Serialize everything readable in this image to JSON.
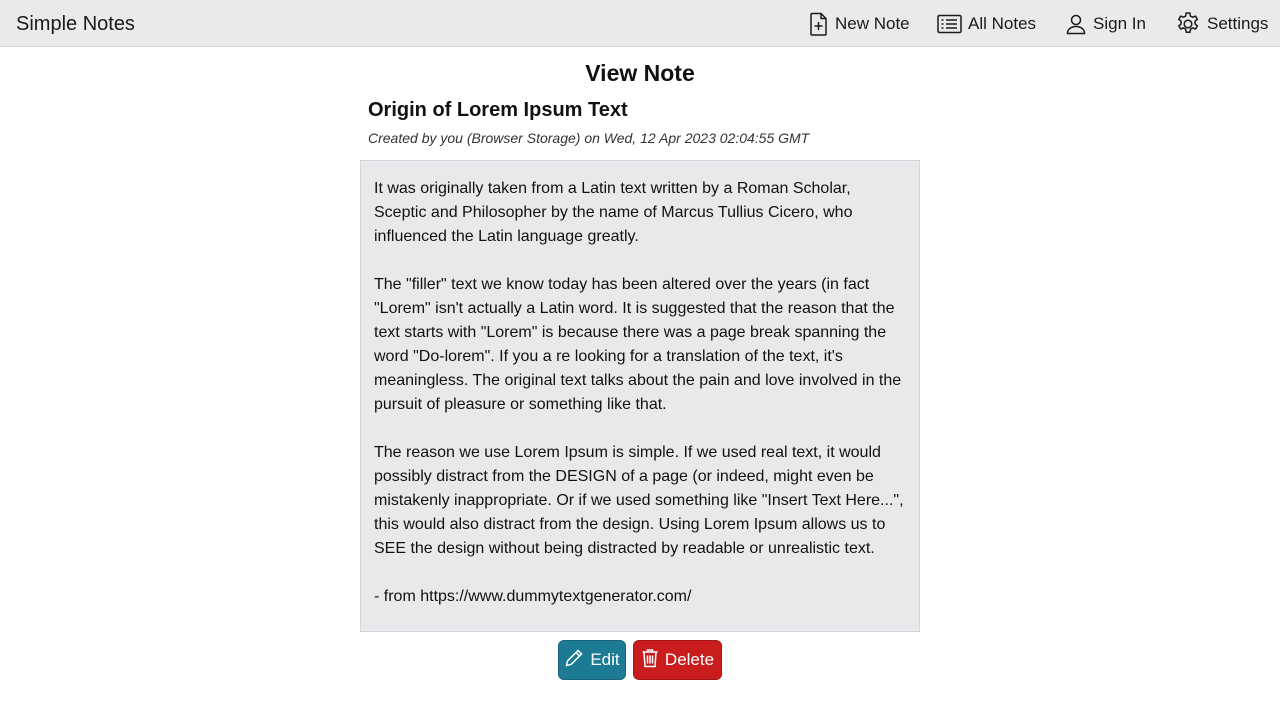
{
  "app": {
    "brand": "Simple Notes"
  },
  "nav": {
    "new_note": "New Note",
    "all_notes": "All Notes",
    "sign_in": "Sign In",
    "settings": "Settings",
    "icons": [
      "file-plus-icon",
      "list-icon",
      "user-icon",
      "gear-icon"
    ]
  },
  "page": {
    "title": "View Note"
  },
  "note": {
    "title": "Origin of Lorem Ipsum Text",
    "meta": "Created by you (Browser Storage) on Wed, 12 Apr 2023 02:04:55 GMT",
    "paragraphs": [
      "It was originally taken from a Latin text written by a Roman Scholar, Sceptic and Philosopher by the name of Marcus Tullius Cicero, who influenced the Latin language greatly.",
      "The \"filler\" text we know today has been altered over the years (in fact \"Lorem\" isn't actually a Latin word. It is suggested that the reason that the text starts with \"Lorem\" is because there was a page break spanning the word \"Do-lorem\". If you a re looking for a translation of the text, it's meaningless. The original text talks about the pain and love involved in the pursuit of pleasure or something like that.",
      "The reason we use Lorem Ipsum is simple. If we used real text, it would possibly distract from the DESIGN of a page (or indeed, might even be mistakenly inappropriate. Or if we used something like \"Insert Text Here...\", this would also distract from the design. Using Lorem Ipsum allows us to SEE the design without being distracted by readable or unrealistic text.",
      "- from https://www.dummytextgenerator.com/"
    ]
  },
  "actions": {
    "edit_label": "Edit",
    "delete_label": "Delete",
    "edit_color": "#1c7a93",
    "delete_color": "#c91c1c",
    "icons": [
      "pencil-icon",
      "trash-icon"
    ]
  }
}
